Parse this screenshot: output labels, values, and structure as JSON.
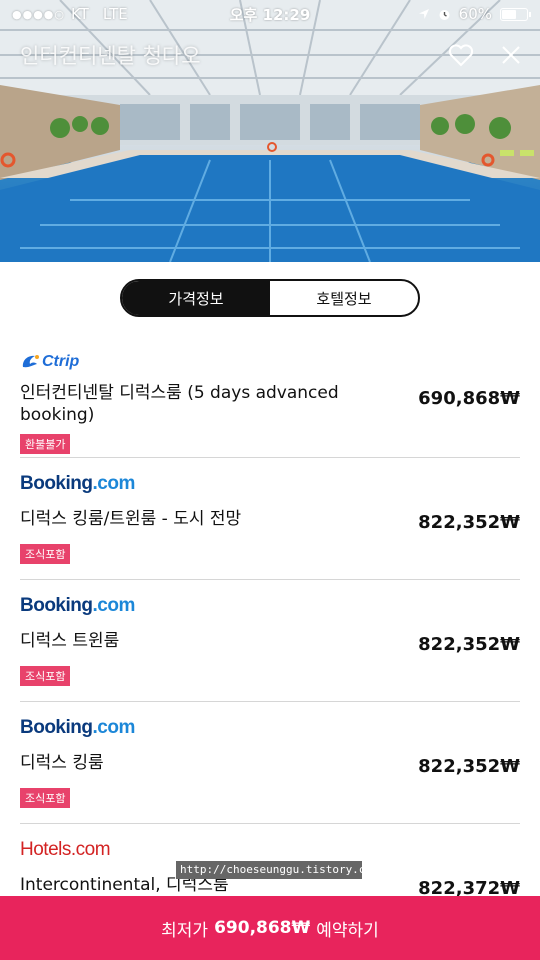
{
  "status_bar": {
    "signal": "●●●●○",
    "carrier": "KT",
    "network": "LTE",
    "time": "오후 12:29",
    "battery": "60%",
    "battery_level": 0.6
  },
  "hero": {
    "title": "인터컨티넨탈 청다오"
  },
  "tabs": [
    {
      "label": "가격정보",
      "active": true
    },
    {
      "label": "호텔정보",
      "active": false
    }
  ],
  "offers": [
    {
      "provider": "Ctrip",
      "room": "인터컨티넨탈 디럭스룸 (5 days advanced booking)",
      "tag": "환불불가",
      "price": "690,868₩"
    },
    {
      "provider": "Booking.com",
      "room": "디럭스 킹룸/트윈룸 - 도시 전망",
      "tag": "조식포함",
      "price": "822,352₩"
    },
    {
      "provider": "Booking.com",
      "room": "디럭스 트윈룸",
      "tag": "조식포함",
      "price": "822,352₩"
    },
    {
      "provider": "Booking.com",
      "room": "디럭스 킹룸",
      "tag": "조식포함",
      "price": "822,352₩"
    },
    {
      "provider": "Hotels.com",
      "room": "Intercontinental, 디럭스룸",
      "tag": "",
      "price": "822,372₩"
    }
  ],
  "logos": {
    "ctrip": "Ctrip",
    "booking_main": "Booking",
    "booking_suffix": ".com",
    "hotels_main": "Hotels",
    "hotels_suffix": ".com"
  },
  "watermark": "http://choeseunggu.tistory.com",
  "cta": {
    "prefix": "최저가",
    "price": "690,868₩",
    "suffix": "예약하기"
  },
  "colors": {
    "accent": "#e8245c",
    "tag": "#e8426b"
  }
}
